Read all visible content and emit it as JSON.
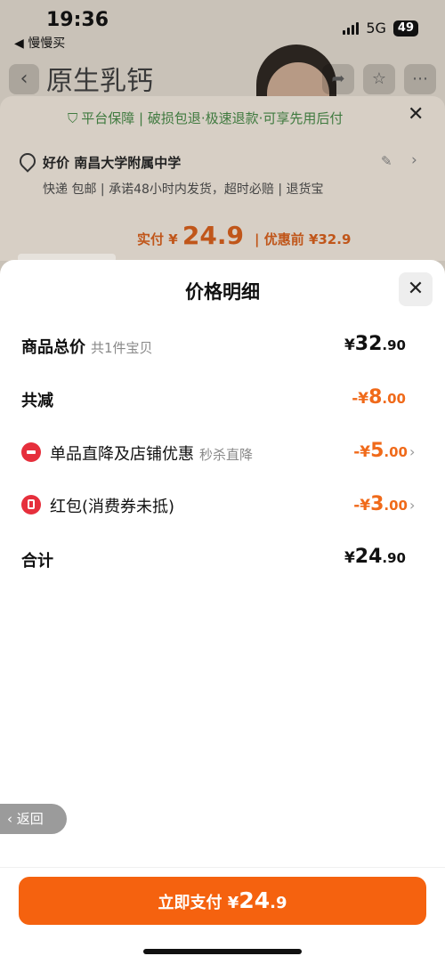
{
  "status_bar": {
    "time": "19:36",
    "back_app": "◀ 慢慢买",
    "network": "5G",
    "battery": "49"
  },
  "background": {
    "title": "原生乳钙",
    "guarantee": "平台保障 | 破损包退·极速退款·可享先用后付",
    "address": "好价 南昌大学附属中学",
    "delivery": "快递 包邮 | 承诺48小时内发货，超时必赔 | 退货宝",
    "paid_label": "实付",
    "paid_currency": "¥",
    "paid_amount": "24.9",
    "before_label": "| 优惠前",
    "before_amount": "¥32.9"
  },
  "sheet": {
    "title": "价格明细",
    "rows": [
      {
        "label": "商品总价",
        "sub": "共1件宝贝",
        "currency": "¥",
        "int": "32",
        "dec": ".90"
      },
      {
        "label": "共减",
        "currency": "-¥",
        "int": "8",
        "dec": ".00"
      },
      {
        "label": "单品直降及店铺优惠",
        "sub": "秒杀直降",
        "currency": "-¥",
        "int": "5",
        "dec": ".00"
      },
      {
        "label": "红包(消费券未抵)",
        "currency": "-¥",
        "int": "3",
        "dec": ".00"
      },
      {
        "label": "合计",
        "currency": "¥",
        "int": "24",
        "dec": ".90"
      }
    ]
  },
  "return_button": "返回",
  "pay_button": {
    "label": "立即支付",
    "currency": "¥",
    "amount": "24",
    "dec": ".9"
  },
  "colors": {
    "accent": "#f5620f",
    "discount": "#f06a1a",
    "icon_red": "#e62f3c",
    "guarantee_green": "#3f7a3f"
  }
}
